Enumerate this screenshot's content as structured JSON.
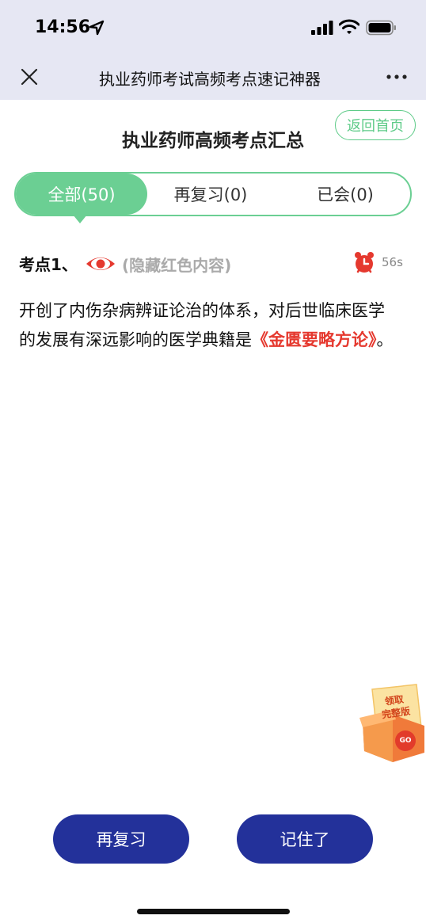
{
  "status_bar": {
    "time": "14:56"
  },
  "nav": {
    "title": "执业药师考试高频考点速记神器"
  },
  "page": {
    "title": "执业药师高频考点汇总",
    "home_button": "返回首页"
  },
  "tabs": [
    {
      "label": "全部(50)",
      "active": true
    },
    {
      "label": "再复习(0)",
      "active": false
    },
    {
      "label": "已会(0)",
      "active": false
    }
  ],
  "point": {
    "label": "考点1、",
    "hide_red_label": "(隐藏红色内容)",
    "timer": "56s",
    "question_text": "开创了内伤杂病辨证论治的体系，对后世临床医学的发展有深远影响的医学典籍是",
    "answer": "《金匮要略方论》",
    "question_end": "。"
  },
  "promo": {
    "line1": "领取",
    "line2": "完整版",
    "go": "GO"
  },
  "actions": {
    "review_label": "再复习",
    "remember_label": "记住了"
  },
  "colors": {
    "accent_green": "#6bcf93",
    "button_blue": "#23319a",
    "answer_red": "#e5392f",
    "nav_bg": "#e6e7f3"
  }
}
